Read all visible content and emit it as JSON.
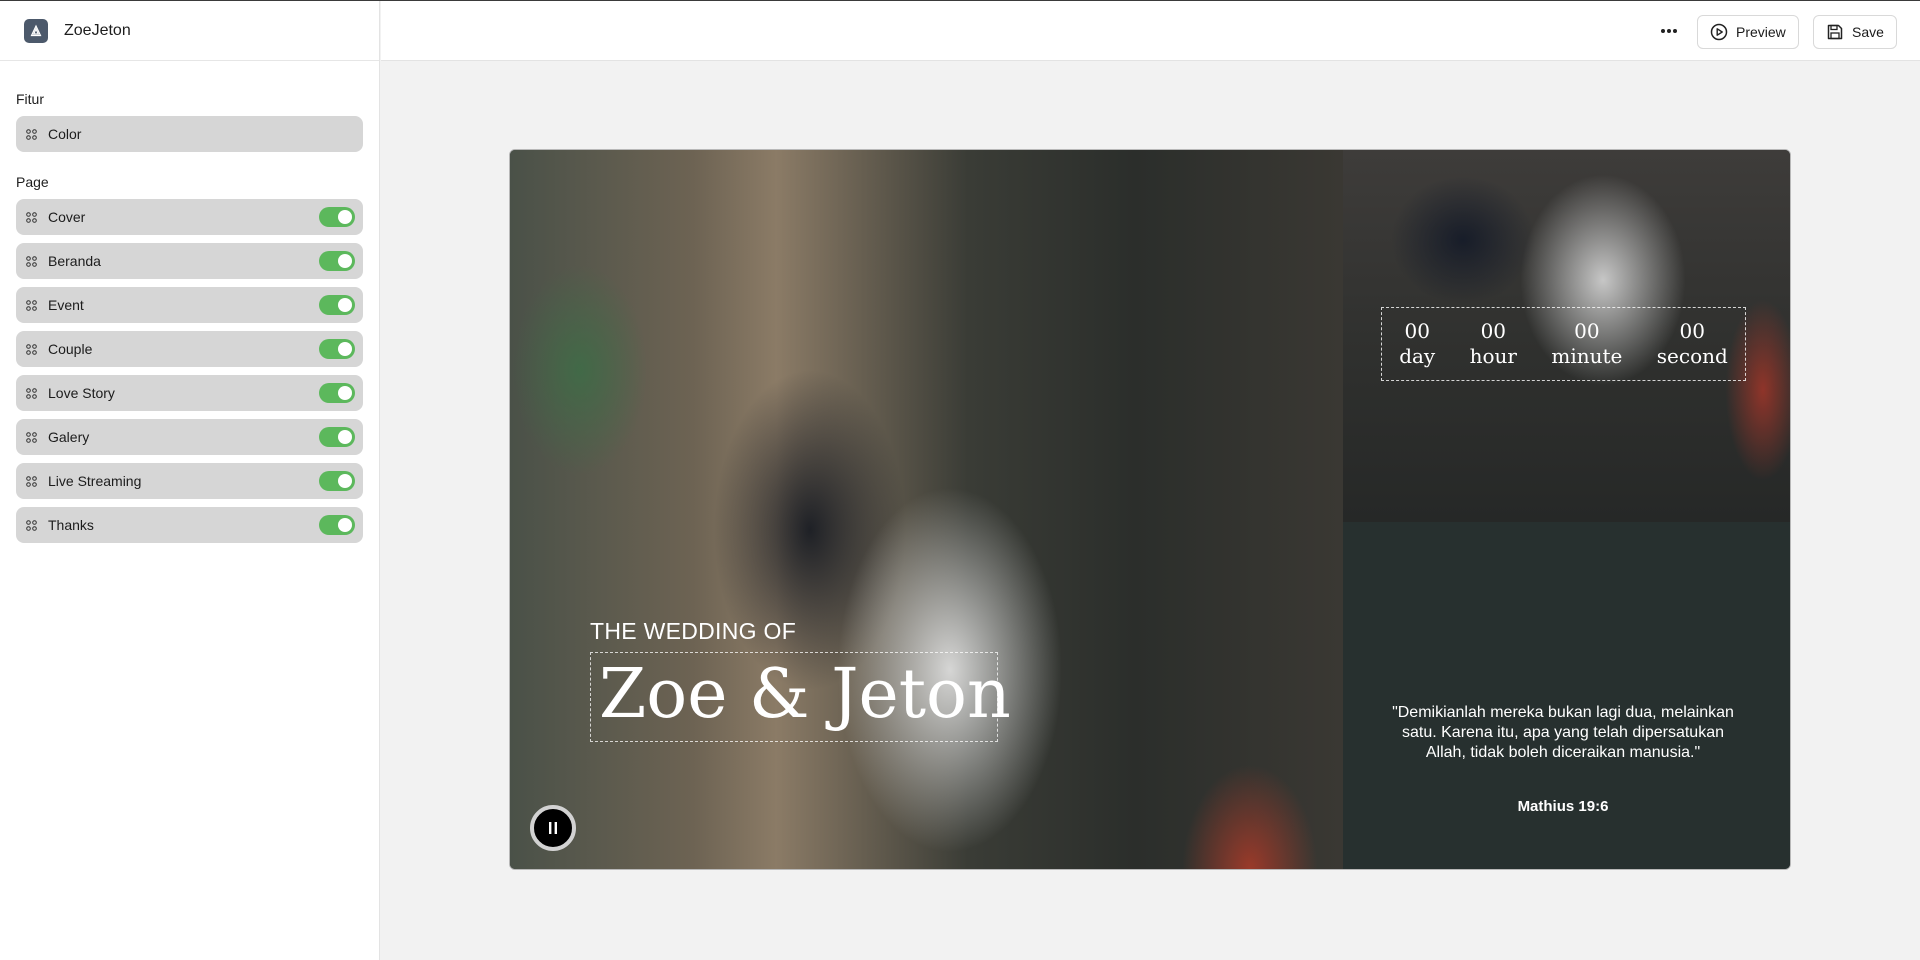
{
  "app": {
    "name": "ZoeJeton"
  },
  "sidebar": {
    "fitur_title": "Fitur",
    "fitur_items": [
      {
        "label": "Color"
      }
    ],
    "page_title": "Page",
    "page_items": [
      {
        "label": "Cover",
        "enabled": true
      },
      {
        "label": "Beranda",
        "enabled": true
      },
      {
        "label": "Event",
        "enabled": true
      },
      {
        "label": "Couple",
        "enabled": true
      },
      {
        "label": "Love Story",
        "enabled": true
      },
      {
        "label": "Galery",
        "enabled": true
      },
      {
        "label": "Live Streaming",
        "enabled": true
      },
      {
        "label": "Thanks",
        "enabled": true
      }
    ]
  },
  "toolbar": {
    "more_icon": "ellipsis-icon",
    "preview_label": "Preview",
    "save_label": "Save"
  },
  "invitation": {
    "heading": "THE WEDDING OF",
    "couple_name": "Zoe & Jeton",
    "countdown": [
      {
        "value": "00",
        "unit": "day"
      },
      {
        "value": "00",
        "unit": "hour"
      },
      {
        "value": "00",
        "unit": "minute"
      },
      {
        "value": "00",
        "unit": "second"
      }
    ],
    "quote": "\"Demikianlah mereka bukan lagi dua, melainkan satu. Karena itu, apa yang telah dipersatukan Allah, tidak boleh diceraikan manusia.\"",
    "verse": "Mathius 19:6"
  },
  "colors": {
    "toggle_on": "#5cb85c",
    "sidebar_item_bg": "#d6d6d6",
    "panel_dark": "#27302f"
  }
}
